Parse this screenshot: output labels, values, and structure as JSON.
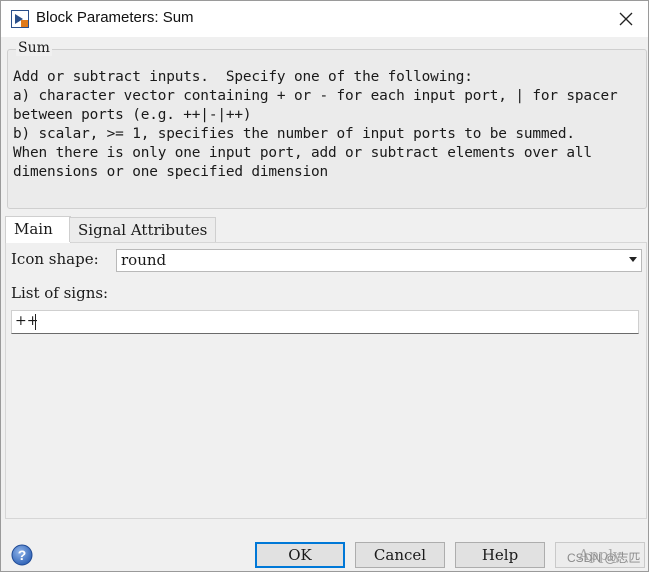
{
  "window": {
    "title": "Block Parameters: Sum"
  },
  "group": {
    "legend": "Sum",
    "description_lines": [
      "Add or subtract inputs.  Specify one of the following:",
      "a) character vector containing + or - for each input port, | for spacer",
      "between ports (e.g. ++|-|++)",
      "b) scalar, >= 1, specifies the number of input ports to be summed.",
      "When there is only one input port, add or subtract elements over all",
      "dimensions or one specified dimension"
    ]
  },
  "tabs": [
    {
      "label": "Main",
      "active": true
    },
    {
      "label": "Signal Attributes",
      "active": false
    }
  ],
  "main": {
    "icon_shape_label": "Icon shape:",
    "icon_shape_value": "round",
    "signs_label": "List of signs:",
    "signs_value": "++"
  },
  "buttons": {
    "ok": "OK",
    "cancel": "Cancel",
    "help": "Help",
    "apply": "Apply"
  },
  "watermark": "CSDN @志匹",
  "icons": [
    "app-icon",
    "close-icon",
    "help-icon",
    "dropdown-arrow-icon"
  ]
}
